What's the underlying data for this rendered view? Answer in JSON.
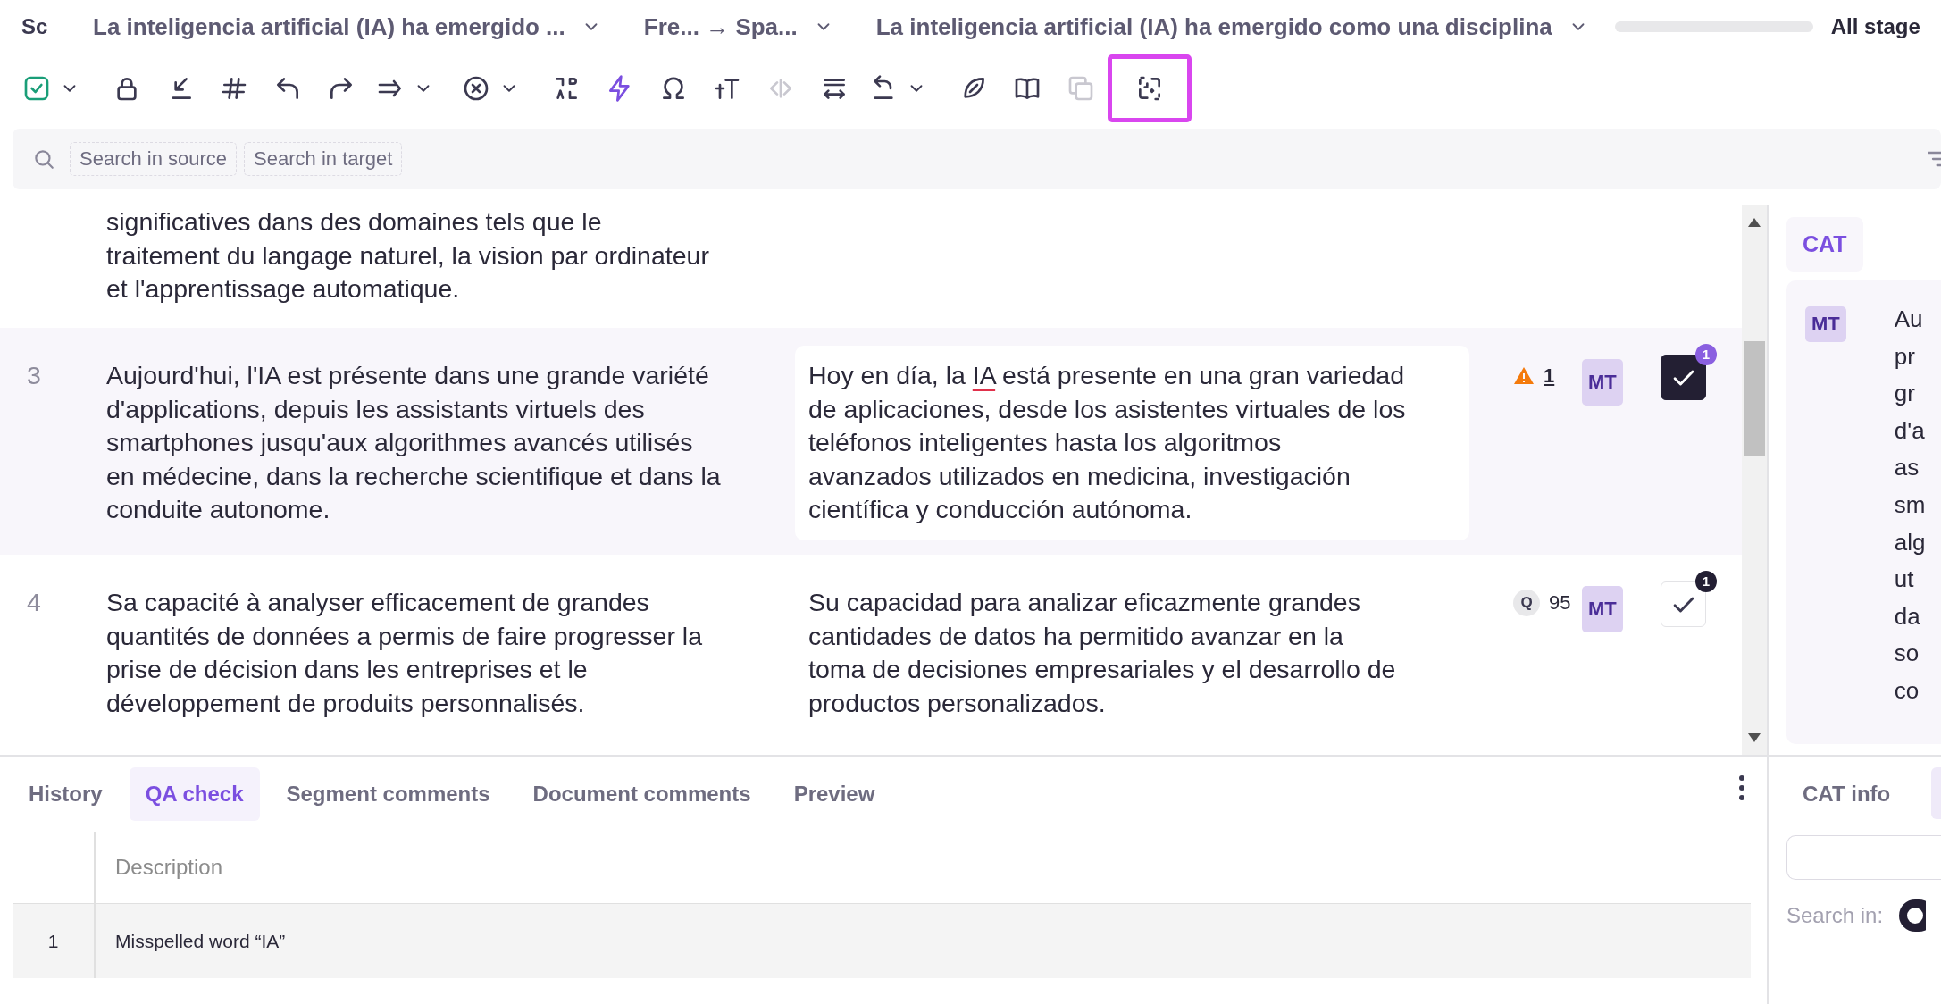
{
  "header": {
    "logo": "Sc",
    "document": "La inteligencia artificial (IA) ha emergido ...",
    "languages": "Fre... → Spa...",
    "segment_preview": "La inteligencia artificial (IA) ha emergido como una disciplina",
    "progress": {
      "level": 0
    },
    "stage_filter": "All stage"
  },
  "toolbar": [
    {
      "kind": "confirm",
      "caret": true,
      "disabled": false,
      "highlighted": false
    },
    {
      "kind": "lock",
      "caret": false,
      "disabled": false,
      "highlighted": false
    },
    {
      "kind": "insert",
      "caret": false,
      "disabled": false,
      "highlighted": false
    },
    {
      "kind": "hash",
      "caret": false,
      "disabled": false,
      "highlighted": false
    },
    {
      "kind": "undo",
      "caret": false,
      "disabled": false,
      "highlighted": false
    },
    {
      "kind": "redo",
      "caret": false,
      "disabled": false,
      "highlighted": false
    },
    {
      "kind": "double-arrow",
      "caret": true,
      "disabled": false,
      "highlighted": false
    },
    {
      "kind": "clear",
      "caret": true,
      "disabled": false,
      "highlighted": false
    },
    {
      "kind": "swap",
      "caret": false,
      "disabled": false,
      "highlighted": false
    },
    {
      "kind": "lightning",
      "caret": false,
      "disabled": false,
      "highlighted": false
    },
    {
      "kind": "omega",
      "caret": false,
      "disabled": false,
      "highlighted": false
    },
    {
      "kind": "text-size",
      "caret": false,
      "disabled": false,
      "highlighted": false
    },
    {
      "kind": "code",
      "caret": false,
      "disabled": true,
      "highlighted": false
    },
    {
      "kind": "wrap",
      "caret": false,
      "disabled": false,
      "highlighted": false
    },
    {
      "kind": "revert",
      "caret": true,
      "disabled": false,
      "highlighted": false
    },
    {
      "kind": "feather",
      "caret": false,
      "disabled": false,
      "highlighted": false
    },
    {
      "kind": "book",
      "caret": false,
      "disabled": false,
      "highlighted": false
    },
    {
      "kind": "copy",
      "caret": false,
      "disabled": true,
      "highlighted": false
    },
    {
      "kind": "split",
      "caret": false,
      "disabled": false,
      "highlighted": true
    }
  ],
  "search": {
    "source_placeholder": "Search in source",
    "target_placeholder": "Search in target"
  },
  "segments": [
    {
      "selected": false,
      "source": [
        "significatives dans des domaines tels que le",
        "traitement du langage naturel, la vision par ordinateur",
        "et l'apprentissage automatique."
      ]
    },
    {
      "number": "3",
      "selected": true,
      "source": [
        "Aujourd'hui, l'IA est présente dans une grande variété",
        "d'applications, depuis les assistants virtuels des",
        "smartphones jusqu'aux algorithmes avancés utilisés",
        "en médecine, dans la recherche scientifique et dans la",
        "conduite autonome."
      ],
      "target": [
        {
          "runs": [
            {
              "text": "Hoy en día, la ",
              "misspelled": false
            },
            {
              "text": "IA",
              "misspelled": true
            },
            {
              "text": " está presente en una gran variedad",
              "misspelled": false
            }
          ]
        },
        "de aplicaciones, desde los asistentes virtuales de los",
        "teléfonos inteligentes hasta los algoritmos",
        "avanzados utilizados en medicina, investigación",
        "científica y conducción autónoma."
      ],
      "status": {
        "kind": "warning",
        "value": "1"
      },
      "origin": "MT",
      "confirmed": true,
      "badge": "1"
    },
    {
      "number": "4",
      "selected": false,
      "source": [
        "Sa capacité à analyser efficacement de grandes",
        "quantités de données a permis de faire progresser la",
        "prise de décision dans les entreprises et le",
        "développement de produits personnalisés."
      ],
      "target": [
        "Su capacidad para analizar eficazmente grandes",
        "cantidades de datos ha permitido avanzar en la",
        "toma de decisiones empresariales y el desarrollo de",
        "productos personalizados."
      ],
      "status": {
        "kind": "match",
        "label": "Q",
        "value": "95"
      },
      "origin": "MT",
      "confirmed": false,
      "badge": "1"
    }
  ],
  "side_panel": {
    "tab": {
      "label": "CAT",
      "selected": true
    },
    "match": {
      "origin": "MT",
      "text_fragments": [
        "Au",
        "pr",
        "gr",
        "d'a",
        "as",
        "sm",
        "alg",
        "ut",
        "da",
        "so",
        "co"
      ]
    }
  },
  "bottom_panel": {
    "tabs": [
      {
        "label": "History",
        "selected": false
      },
      {
        "label": "QA check",
        "selected": true
      },
      {
        "label": "Segment comments",
        "selected": false
      },
      {
        "label": "Document comments",
        "selected": false
      },
      {
        "label": "Preview",
        "selected": false
      }
    ],
    "qa_table": {
      "columns": [
        "Description"
      ],
      "rows": [
        {
          "number": "1",
          "description": "Misspelled word “IA”"
        }
      ]
    }
  },
  "cat_info_panel": {
    "tabs": [
      {
        "label": "CAT info",
        "selected": false
      },
      {
        "selected": true
      }
    ],
    "search_label": "Search in:"
  }
}
